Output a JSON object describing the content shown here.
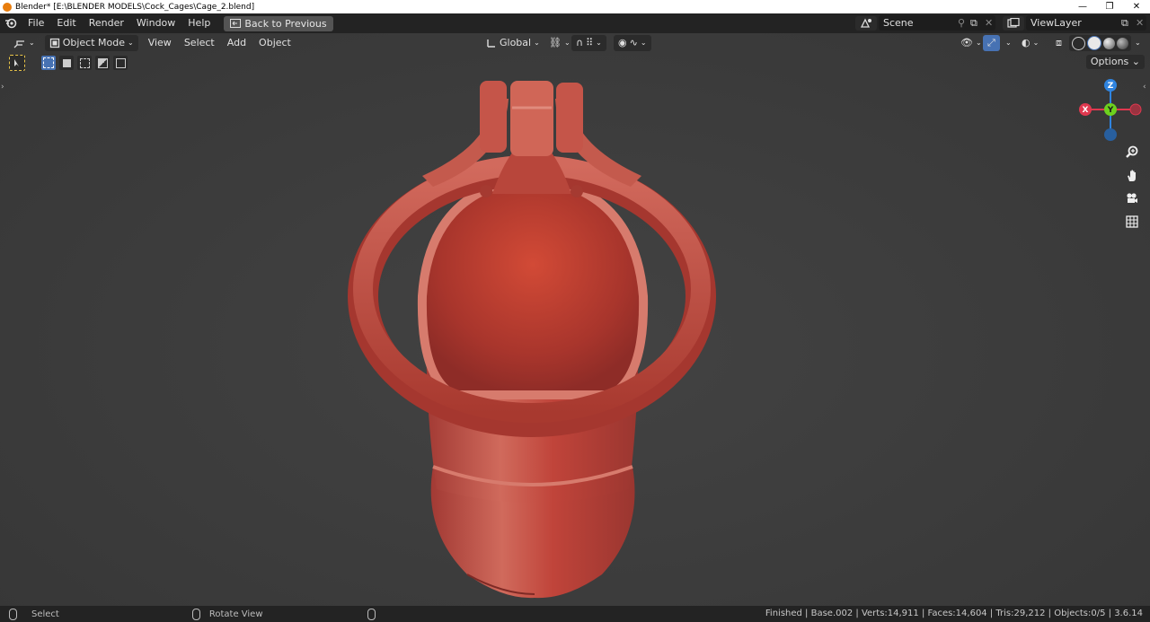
{
  "window": {
    "title": "Blender* [E:\\BLENDER MODELS\\Cock_Cages\\Cage_2.blend]",
    "minimize": "—",
    "restore": "❐",
    "close": "✕"
  },
  "topbar": {
    "menus": [
      "File",
      "Edit",
      "Render",
      "Window",
      "Help"
    ],
    "back_label": "Back to Previous",
    "scene": "Scene",
    "view_layer": "ViewLayer"
  },
  "viewport_header": {
    "mode": "Object Mode",
    "menus": [
      "View",
      "Select",
      "Add",
      "Object"
    ],
    "orientation": "Global",
    "options_label": "Options"
  },
  "gizmo": {
    "z": "Z",
    "x": "X",
    "y": "Y"
  },
  "statusbar": {
    "select": "Select",
    "rotate": "Rotate View",
    "stats": "Finished | Base.002 | Verts:14,911 | Faces:14,604 | Tris:29,212 | Objects:0/5 | 3.6.14"
  },
  "colors": {
    "model": "#c0443a",
    "axis_x": "#e0384f",
    "axis_y": "#6dd11e",
    "axis_z": "#2f84e0",
    "active_blue": "#4772b3"
  }
}
